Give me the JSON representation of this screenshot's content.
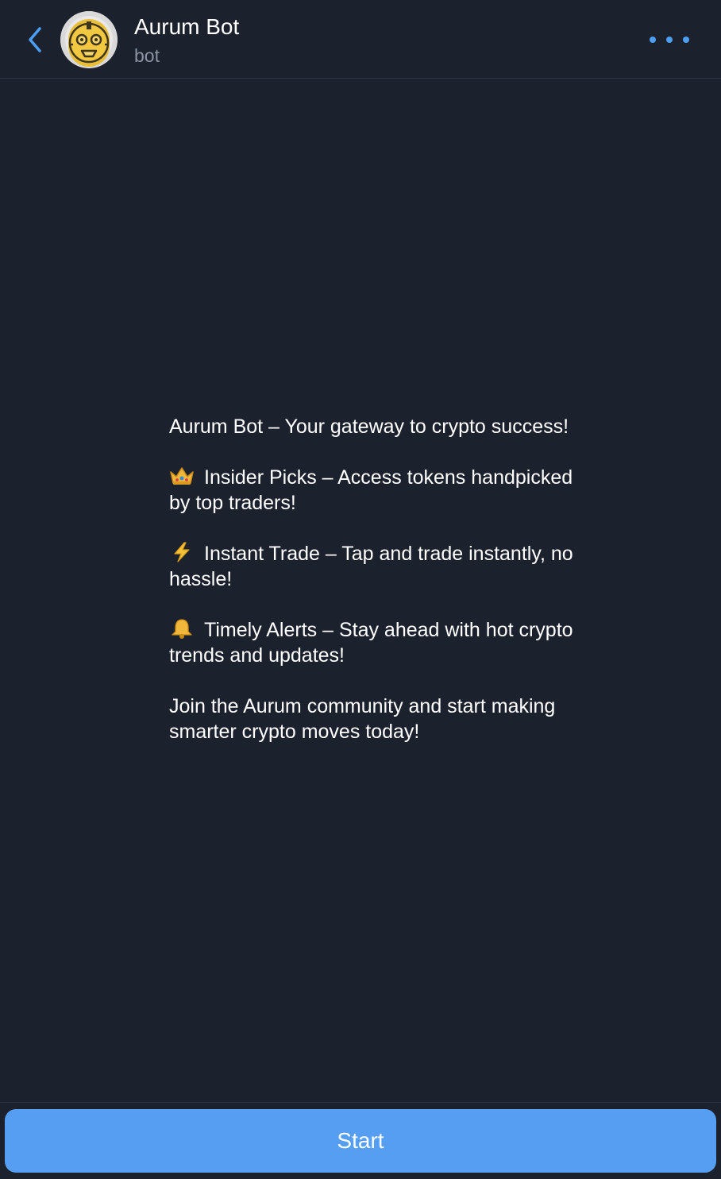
{
  "header": {
    "title": "Aurum Bot",
    "subtitle": "bot",
    "back_icon": "chevron-left-icon",
    "more_icon": "more-horizontal-icon",
    "accent_color": "#4d9ef5"
  },
  "intro": {
    "headline": "Aurum Bot – Your gateway to crypto success!",
    "features": [
      {
        "icon": "crown-icon",
        "text": "Insider Picks – Access tokens handpicked by top traders!"
      },
      {
        "icon": "lightning-icon",
        "text": "Instant Trade – Tap and trade instantly, no hassle!"
      },
      {
        "icon": "bell-icon",
        "text": "Timely Alerts – Stay ahead with hot crypto trends and updates!"
      }
    ],
    "closing": "Join the Aurum community and start making smarter crypto moves today!"
  },
  "footer": {
    "start_label": "Start",
    "button_color": "#559ef2"
  },
  "theme": {
    "background": "#1c222d",
    "divider": "#2b3443",
    "muted_text": "#8a94a4"
  }
}
